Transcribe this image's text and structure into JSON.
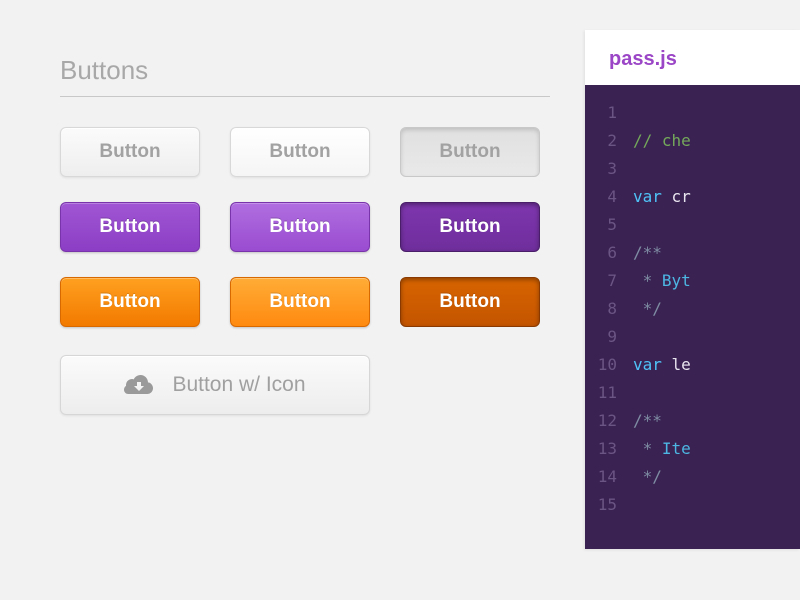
{
  "section_title": "Buttons",
  "buttons": {
    "gray": {
      "label": "Button"
    },
    "purple": {
      "label": "Button"
    },
    "orange": {
      "label": "Button"
    },
    "icon": {
      "label": "Button w/ Icon"
    }
  },
  "code": {
    "filename": "pass.js",
    "lines": [
      {
        "n": "1",
        "segments": []
      },
      {
        "n": "2",
        "segments": [
          {
            "cls": "c-comment",
            "text": "// che"
          }
        ]
      },
      {
        "n": "3",
        "segments": []
      },
      {
        "n": "4",
        "segments": [
          {
            "cls": "c-kw",
            "text": "var "
          },
          {
            "cls": "c-plain",
            "text": "cr"
          }
        ]
      },
      {
        "n": "5",
        "segments": []
      },
      {
        "n": "6",
        "segments": [
          {
            "cls": "c-doccomment",
            "text": "/**"
          }
        ]
      },
      {
        "n": "7",
        "segments": [
          {
            "cls": "c-doccomment",
            "text": " * "
          },
          {
            "cls": "c-star",
            "text": "Byt"
          }
        ]
      },
      {
        "n": "8",
        "segments": [
          {
            "cls": "c-doccomment",
            "text": " */"
          }
        ]
      },
      {
        "n": "9",
        "segments": []
      },
      {
        "n": "10",
        "segments": [
          {
            "cls": "c-kw",
            "text": "var "
          },
          {
            "cls": "c-plain",
            "text": "le"
          }
        ]
      },
      {
        "n": "11",
        "segments": []
      },
      {
        "n": "12",
        "segments": [
          {
            "cls": "c-doccomment",
            "text": "/**"
          }
        ]
      },
      {
        "n": "13",
        "segments": [
          {
            "cls": "c-doccomment",
            "text": " * "
          },
          {
            "cls": "c-star",
            "text": "Ite"
          }
        ]
      },
      {
        "n": "14",
        "segments": [
          {
            "cls": "c-doccomment",
            "text": " */"
          }
        ]
      },
      {
        "n": "15",
        "segments": []
      }
    ]
  }
}
